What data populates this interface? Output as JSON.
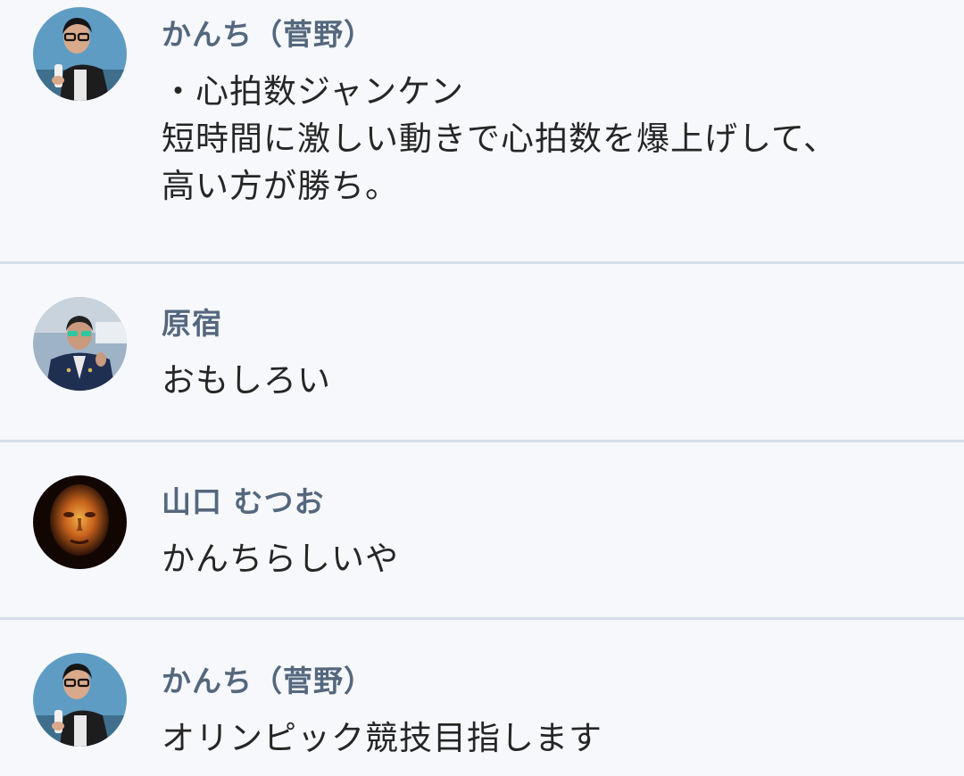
{
  "comments": [
    {
      "author": "かんち（菅野）",
      "avatar": "avatar-kanchi",
      "lines": [
        "・心拍数ジャンケン",
        "短時間に激しい動きで心拍数を爆上げして、",
        "高い方が勝ち。"
      ]
    },
    {
      "author": "原宿",
      "avatar": "avatar-harajuku",
      "lines": [
        "おもしろい"
      ]
    },
    {
      "author": "山口 むつお",
      "avatar": "avatar-yamaguchi",
      "lines": [
        "かんちらしいや"
      ]
    },
    {
      "author": "かんち（菅野）",
      "avatar": "avatar-kanchi",
      "lines": [
        "オリンピック競技目指します"
      ]
    }
  ],
  "colors": {
    "background": "#f6f8fb",
    "author": "#54677d",
    "text": "#262626",
    "divider": "#d5dde8"
  }
}
